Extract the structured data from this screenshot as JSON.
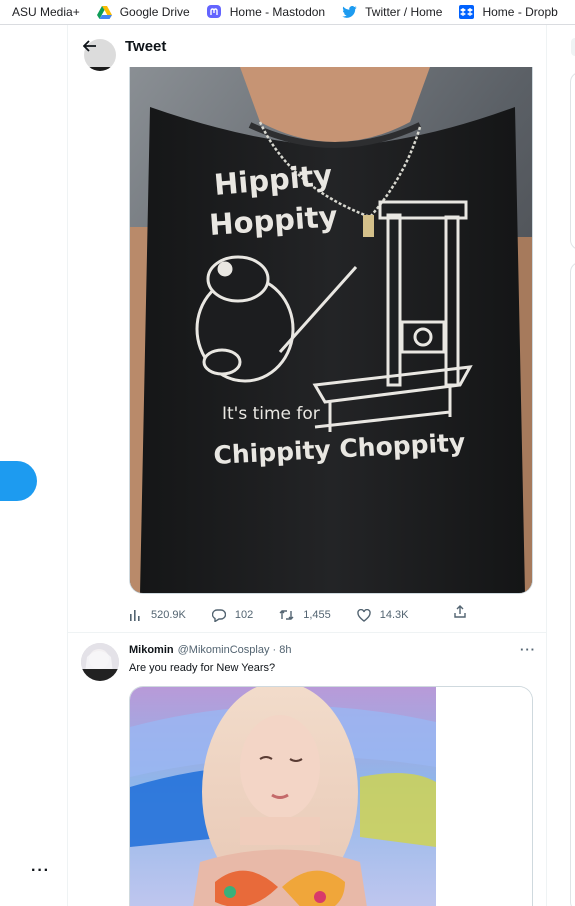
{
  "bookmarks": [
    {
      "label": "ASU Media+",
      "icon": "asu-icon"
    },
    {
      "label": "Google Drive",
      "icon": "google-drive-icon"
    },
    {
      "label": "Home - Mastodon",
      "icon": "mastodon-icon"
    },
    {
      "label": "Twitter / Home",
      "icon": "twitter-bird-icon"
    },
    {
      "label": "Home - Dropb",
      "icon": "dropbox-icon"
    }
  ],
  "header": {
    "title": "Tweet"
  },
  "tweet1": {
    "shirt_text": {
      "line1": "Hippity",
      "line2": "Hoppity",
      "line3": "It's time for",
      "line4": "Chippity Choppity"
    },
    "stats": {
      "views": "520.9K",
      "replies": "102",
      "retweets": "1,455",
      "likes": "14.3K"
    }
  },
  "tweet2": {
    "name": "Mikomin",
    "handle": "@MikominCosplay",
    "time": "· 8h",
    "text": "Are you ready for New Years?",
    "more": "···"
  },
  "nav": {
    "more": "···"
  },
  "colors": {
    "accent": "#1d9bf0",
    "muted": "#536471",
    "border": "#eff3f4"
  }
}
